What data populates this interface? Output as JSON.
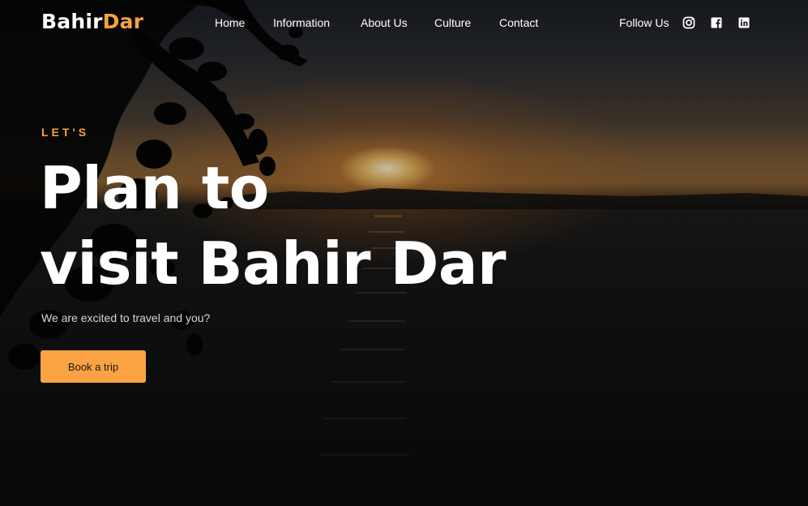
{
  "brand": {
    "name_part1": "Bahir",
    "name_part2": "Dar",
    "accent_color": "#f5a142"
  },
  "nav": {
    "items": [
      {
        "label": "Home"
      },
      {
        "label": "Information"
      },
      {
        "label": "About Us"
      },
      {
        "label": "Culture"
      },
      {
        "label": "Contact"
      }
    ]
  },
  "social": {
    "label": "Follow Us",
    "icons": [
      "instagram-icon",
      "facebook-icon",
      "linkedin-icon"
    ]
  },
  "hero": {
    "kicker": "LET'S",
    "headline_line1": "Plan to",
    "headline_line2": "visit Bahir Dar",
    "subtitle": "We are excited to travel and you?",
    "cta_label": "Book a trip",
    "cta_color": "#fba342",
    "background": "sunset-over-lake-photo"
  }
}
